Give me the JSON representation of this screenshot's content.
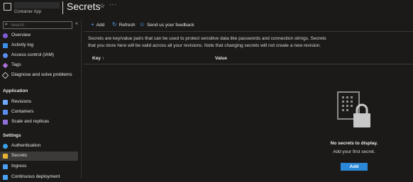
{
  "header": {
    "resource_type": "Container App",
    "title": "Secrets"
  },
  "sidebar": {
    "search_placeholder": "Search",
    "items": [
      {
        "label": "Overview",
        "color": "#7f5cd6"
      },
      {
        "label": "Activity log",
        "color": "#3a8ee6"
      },
      {
        "label": "Access control (IAM)",
        "color": "#5b8def"
      },
      {
        "label": "Tags",
        "color": "#a86fd6"
      },
      {
        "label": "Diagnose and solve problems",
        "color": "#bdbdbd"
      }
    ],
    "sections": [
      {
        "title": "Application",
        "items": [
          {
            "label": "Revisions",
            "color": "#6fa8ff"
          },
          {
            "label": "Containers",
            "color": "#5b8def"
          },
          {
            "label": "Scale and replicas",
            "color": "#8f6fd6"
          }
        ]
      },
      {
        "title": "Settings",
        "items": [
          {
            "label": "Authentication",
            "color": "#3aa0e6"
          },
          {
            "label": "Secrets",
            "color": "#e6b432"
          },
          {
            "label": "Ingress",
            "color": "#4aa0f0"
          },
          {
            "label": "Continuous deployment",
            "color": "#4aa0f0"
          }
        ]
      }
    ]
  },
  "toolbar": {
    "add": "Add",
    "refresh": "Refresh",
    "feedback": "Send us your feedback"
  },
  "description": "Secrets are key/value pairs that can be used to protect sensitive data like passwords and connection strings. Secrets that you store here will be valid across all your revisions. Note that changing secrets will not create a new revision.",
  "table": {
    "key_header": "Key ↑",
    "value_header": "Value"
  },
  "empty_state": {
    "title": "No secrets to display.",
    "subtitle": "Add your first secret.",
    "button": "Add"
  },
  "colors": {
    "accent": "#2b88d8",
    "selected_bg": "#3b3a39",
    "background": "#1b1a19"
  }
}
